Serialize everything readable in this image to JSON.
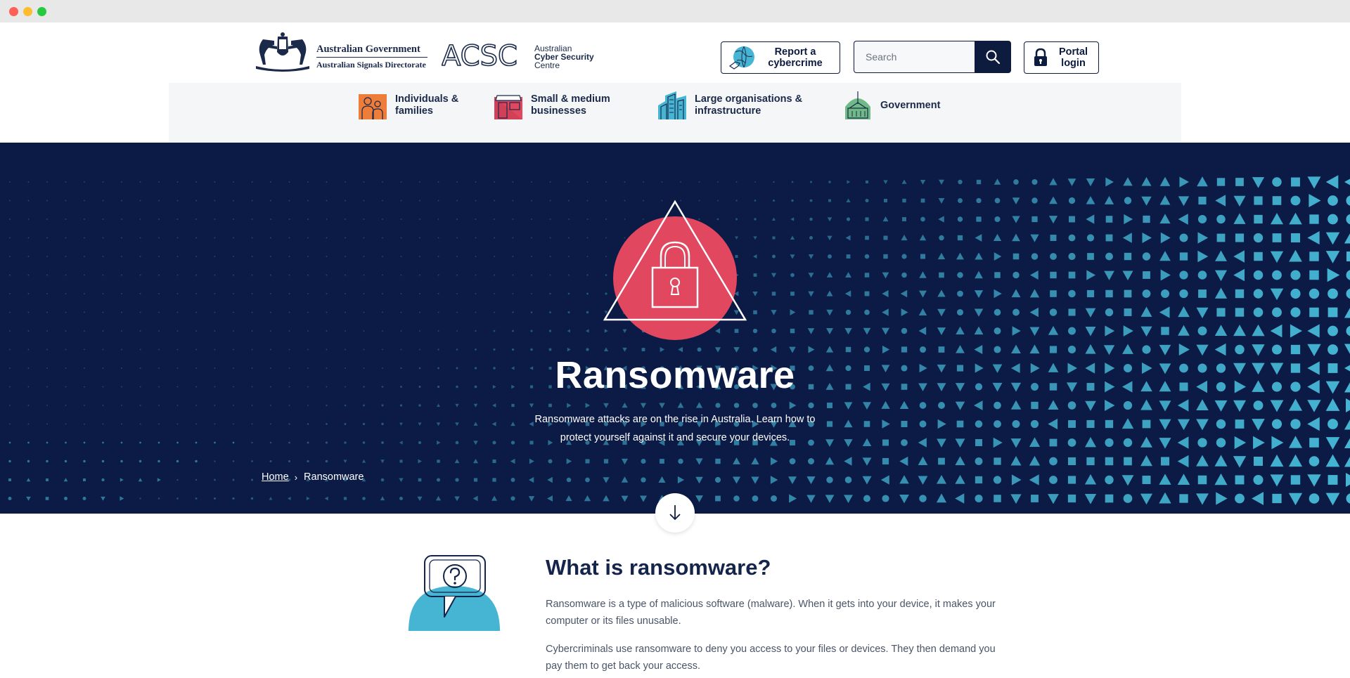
{
  "header": {
    "gov_line1": "Australian Government",
    "gov_line2": "Australian Signals Directorate",
    "acsc_logo": "ACSC",
    "acsc_line1": "Australian",
    "acsc_line2": "Cyber Security",
    "acsc_line3": "Centre",
    "report_label": "Report a cybercrime",
    "search_placeholder": "Search",
    "portal_label": "Portal login"
  },
  "nav": {
    "items": [
      {
        "label": "Individuals & families",
        "icon": "family-icon",
        "color": "#ef7d3a"
      },
      {
        "label": "Small & medium businesses",
        "icon": "shopfront-icon",
        "color": "#e1475f"
      },
      {
        "label": "Large organisations & infrastructure",
        "icon": "buildings-icon",
        "color": "#45b5d3"
      },
      {
        "label": "Government",
        "icon": "parliament-icon",
        "color": "#6fba86"
      }
    ]
  },
  "hero": {
    "title": "Ransomware",
    "description": "Ransomware attacks are on the rise in Australia. Learn how to protect yourself against it and secure your devices.",
    "icon": "padlock-warning-icon",
    "accent": "#e1475f",
    "background": "#0c1b46",
    "pattern_color": "#45b5d3"
  },
  "breadcrumb": {
    "home": "Home",
    "separator": "›",
    "current": "Ransomware"
  },
  "content": {
    "title": "What is ransomware?",
    "paragraph1": "Ransomware is a type of malicious software (malware). When it gets into your device, it makes your computer or its files unusable.",
    "paragraph2": "Cybercriminals use ransomware to deny you access to your files or devices. They then demand you pay them to get back your access.",
    "illustration": "question-speech-bubble-icon"
  }
}
